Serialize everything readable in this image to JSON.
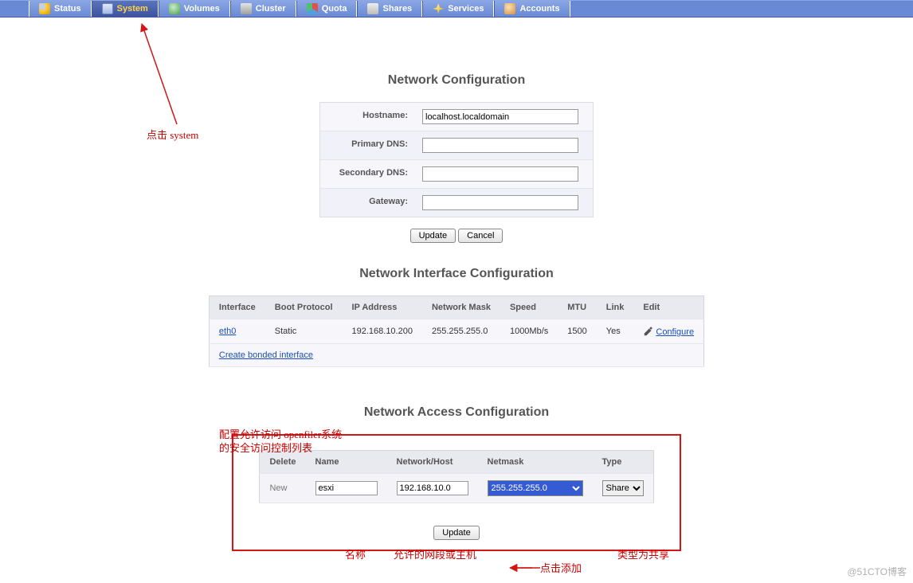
{
  "nav": {
    "tabs": [
      {
        "label": "Status",
        "icon": "status"
      },
      {
        "label": "System",
        "icon": "system",
        "active": true
      },
      {
        "label": "Volumes",
        "icon": "volumes"
      },
      {
        "label": "Cluster",
        "icon": "cluster"
      },
      {
        "label": "Quota",
        "icon": "quota"
      },
      {
        "label": "Shares",
        "icon": "shares"
      },
      {
        "label": "Services",
        "icon": "services"
      },
      {
        "label": "Accounts",
        "icon": "accounts"
      }
    ]
  },
  "sections": {
    "network_config": "Network Configuration",
    "interface_config": "Network Interface Configuration",
    "access_config": "Network Access Configuration"
  },
  "netform": {
    "hostname_label": "Hostname:",
    "hostname_value": "localhost.localdomain",
    "primary_dns_label": "Primary DNS:",
    "primary_dns_value": "",
    "secondary_dns_label": "Secondary DNS:",
    "secondary_dns_value": "",
    "gateway_label": "Gateway:",
    "gateway_value": "",
    "update_btn": "Update",
    "cancel_btn": "Cancel"
  },
  "iface": {
    "headers": {
      "interface": "Interface",
      "boot": "Boot Protocol",
      "ip": "IP Address",
      "mask": "Network Mask",
      "speed": "Speed",
      "mtu": "MTU",
      "link": "Link",
      "edit": "Edit"
    },
    "row": {
      "interface": "eth0",
      "boot": "Static",
      "ip": "192.168.10.200",
      "mask": "255.255.255.0",
      "speed": "1000Mb/s",
      "mtu": "1500",
      "link": "Yes",
      "edit": "Configure"
    },
    "bonded": "Create bonded interface"
  },
  "access": {
    "headers": {
      "delete": "Delete",
      "name": "Name",
      "host": "Network/Host",
      "netmask": "Netmask",
      "type": "Type"
    },
    "new_label": "New",
    "row": {
      "name": "esxi",
      "host": "192.168.10.0",
      "netmask": "255.255.255.0",
      "type": "Share"
    },
    "update_btn": "Update"
  },
  "annotations": {
    "click_system": "点击 system",
    "acl_desc": "配置允许访问 openfiler系统\n的安全访问控制列表",
    "name_label": "名称",
    "host_label": "允许的网段或主机",
    "type_label": "类型为共享",
    "click_add": "点击添加"
  },
  "watermark": "@51CTO博客"
}
